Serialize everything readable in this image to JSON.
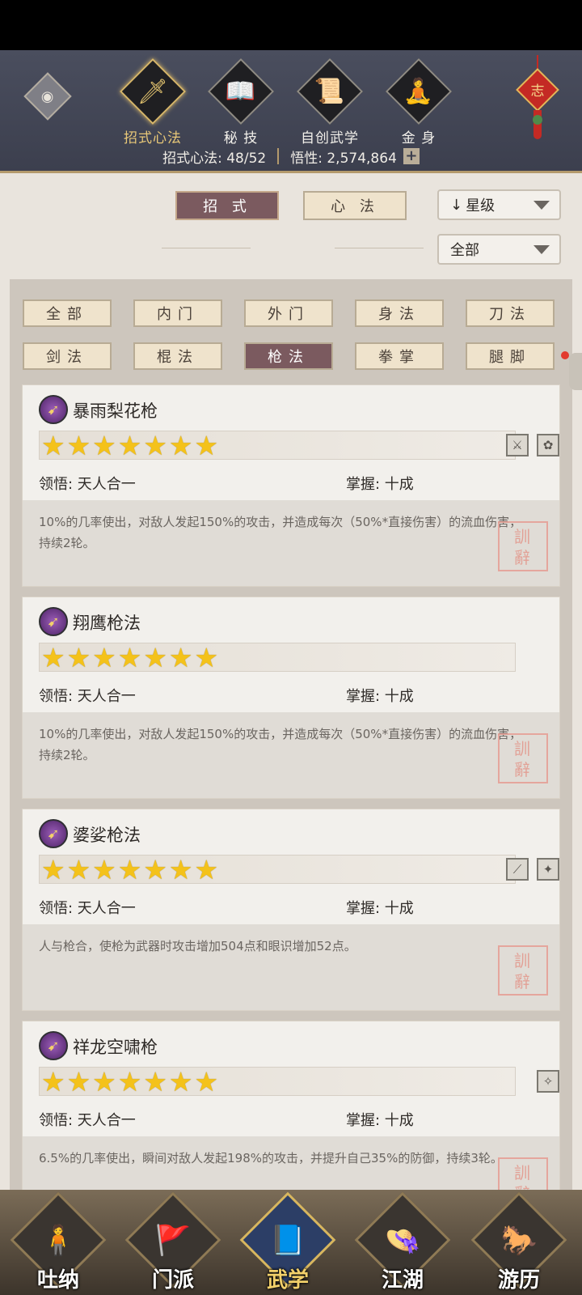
{
  "header": {
    "tabs": [
      {
        "label": "招式心法",
        "icon": "sword-icon",
        "glyph": "🗡",
        "active": true
      },
      {
        "label": "秘 技",
        "icon": "book-icon",
        "glyph": "📖",
        "active": false
      },
      {
        "label": "自创武学",
        "icon": "scroll-icon",
        "glyph": "📜",
        "active": false
      },
      {
        "label": "金 身",
        "icon": "meditation-icon",
        "glyph": "🧘",
        "active": false
      }
    ],
    "stats": {
      "techniques": "招式心法: 48/52",
      "insight": "悟性: 2,574,864"
    },
    "knot_char": "志"
  },
  "segments": {
    "moves": "招 式",
    "mental": "心 法"
  },
  "dropdowns": {
    "sort": "星级",
    "sort_arrow": "↓",
    "filter": "全部"
  },
  "categories": {
    "row1": [
      "全部",
      "内门",
      "外门",
      "身法",
      "刀法"
    ],
    "row2": [
      "剑法",
      "棍法",
      "枪法",
      "拳掌",
      "腿脚"
    ],
    "active": "枪法"
  },
  "cards": [
    {
      "name": "暴雨梨花枪",
      "stars": "★★★★★★★",
      "star_count": 7,
      "ling": "领悟: 天人合一",
      "zhang": "掌握: 十成",
      "desc": "10%的几率使出，对敌人发起150%的攻击，并造成每次（50%*直接伤害）的流血伤害，持续2轮。",
      "icons": [
        "blade-cross-icon",
        "flower-icon"
      ]
    },
    {
      "name": "翔鹰枪法",
      "stars": "★★★★★★★",
      "star_count": 7,
      "ling": "领悟: 天人合一",
      "zhang": "掌握: 十成",
      "desc": "10%的几率使出，对敌人发起150%的攻击，并造成每次（50%*直接伤害）的流血伤害，持续2轮。",
      "icons": []
    },
    {
      "name": "婆娑枪法",
      "stars": "★★★★★★★",
      "star_count": 7,
      "ling": "领悟: 天人合一",
      "zhang": "掌握: 十成",
      "desc": "人与枪合，使枪为武器时攻击增加504点和眼识增加52点。",
      "icons": [
        "spear-icon",
        "bird-icon"
      ]
    },
    {
      "name": "祥龙空啸枪",
      "stars": "★★★★★★★",
      "star_count": 7,
      "ling": "领悟: 天人合一",
      "zhang": "掌握: 十成",
      "desc": "6.5%的几率使出，瞬间对敌人发起198%的攻击，并提升自己35%的防御，持续3轮。",
      "icons": [
        "dragon-icon"
      ]
    }
  ],
  "bottom_nav": [
    {
      "label": "吐纳",
      "glyph": "🧍",
      "icon": "figure-icon",
      "active": false
    },
    {
      "label": "门派",
      "glyph": "🚩",
      "icon": "banner-icon",
      "active": false
    },
    {
      "label": "武学",
      "glyph": "📘",
      "icon": "manual-icon",
      "active": true
    },
    {
      "label": "江湖",
      "glyph": "👒",
      "icon": "straw-hat-icon",
      "active": false
    },
    {
      "label": "游历",
      "glyph": "🐎",
      "icon": "horse-icon",
      "active": false
    }
  ]
}
